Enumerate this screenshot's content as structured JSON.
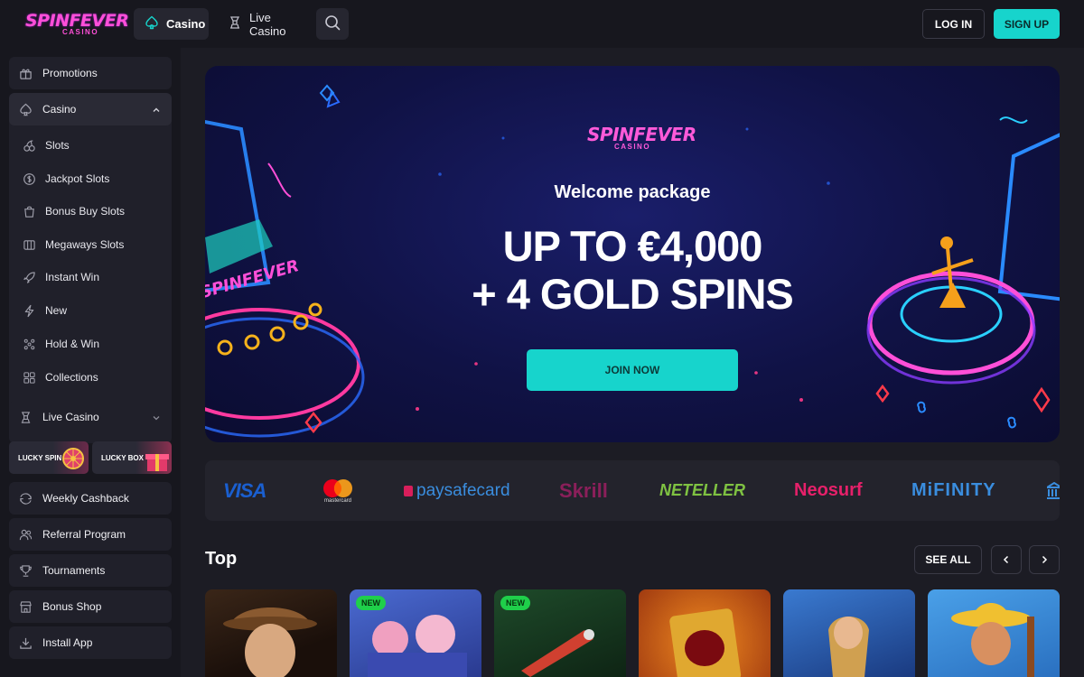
{
  "header": {
    "logo": {
      "main": "SPINFEVER",
      "sub": "CASINO"
    },
    "tabs": [
      {
        "label": "Casino",
        "icon": "spade-icon"
      },
      {
        "label": "Live Casino",
        "icon": "dealer-icon"
      }
    ],
    "search_icon": "search-icon",
    "login_label": "LOG IN",
    "signup_label": "SIGN UP",
    "accent": "#17d4cc"
  },
  "sidebar": {
    "items": [
      {
        "label": "Promotions",
        "icon": "gift-icon"
      },
      {
        "label": "Casino",
        "icon": "spade-icon"
      }
    ],
    "casino_sub": [
      {
        "label": "Slots",
        "icon": "cherries-icon"
      },
      {
        "label": "Jackpot Slots",
        "icon": "coin-icon"
      },
      {
        "label": "Bonus Buy Slots",
        "icon": "bag-icon"
      },
      {
        "label": "Megaways Slots",
        "icon": "slot-icon"
      },
      {
        "label": "Instant Win",
        "icon": "rocket-icon"
      },
      {
        "label": "New",
        "icon": "bolt-icon"
      },
      {
        "label": "Hold & Win",
        "icon": "dots-icon"
      },
      {
        "label": "Collections",
        "icon": "grid-icon"
      }
    ],
    "live_casino": "Live Casino",
    "promo_cards": [
      "LUCKY SPIN",
      "LUCKY BOX"
    ],
    "bottom": [
      {
        "label": "Weekly Cashback",
        "icon": "cashback-icon"
      },
      {
        "label": "Referral Program",
        "icon": "users-icon"
      },
      {
        "label": "Tournaments",
        "icon": "trophy-icon"
      },
      {
        "label": "Bonus Shop",
        "icon": "shop-icon"
      },
      {
        "label": "Install App",
        "icon": "download-icon"
      }
    ]
  },
  "hero": {
    "logo_main": "SPINFEVER",
    "logo_sub": "CASINO",
    "subtitle": "Welcome package",
    "line1": "UP TO €4,000",
    "line2": "+ 4 GOLD SPINS",
    "cta": "JOIN NOW"
  },
  "payments": [
    "VISA",
    "mastercard",
    "paysafecard",
    "Skrill",
    "NETELLER",
    "Neosurf",
    "MiFINITY"
  ],
  "top_section": {
    "title": "Top",
    "see_all": "SEE ALL",
    "games": [
      {
        "new": false
      },
      {
        "new": true,
        "badge": "NEW"
      },
      {
        "new": true,
        "badge": "NEW"
      },
      {
        "new": false
      },
      {
        "new": false
      },
      {
        "new": false
      }
    ]
  }
}
